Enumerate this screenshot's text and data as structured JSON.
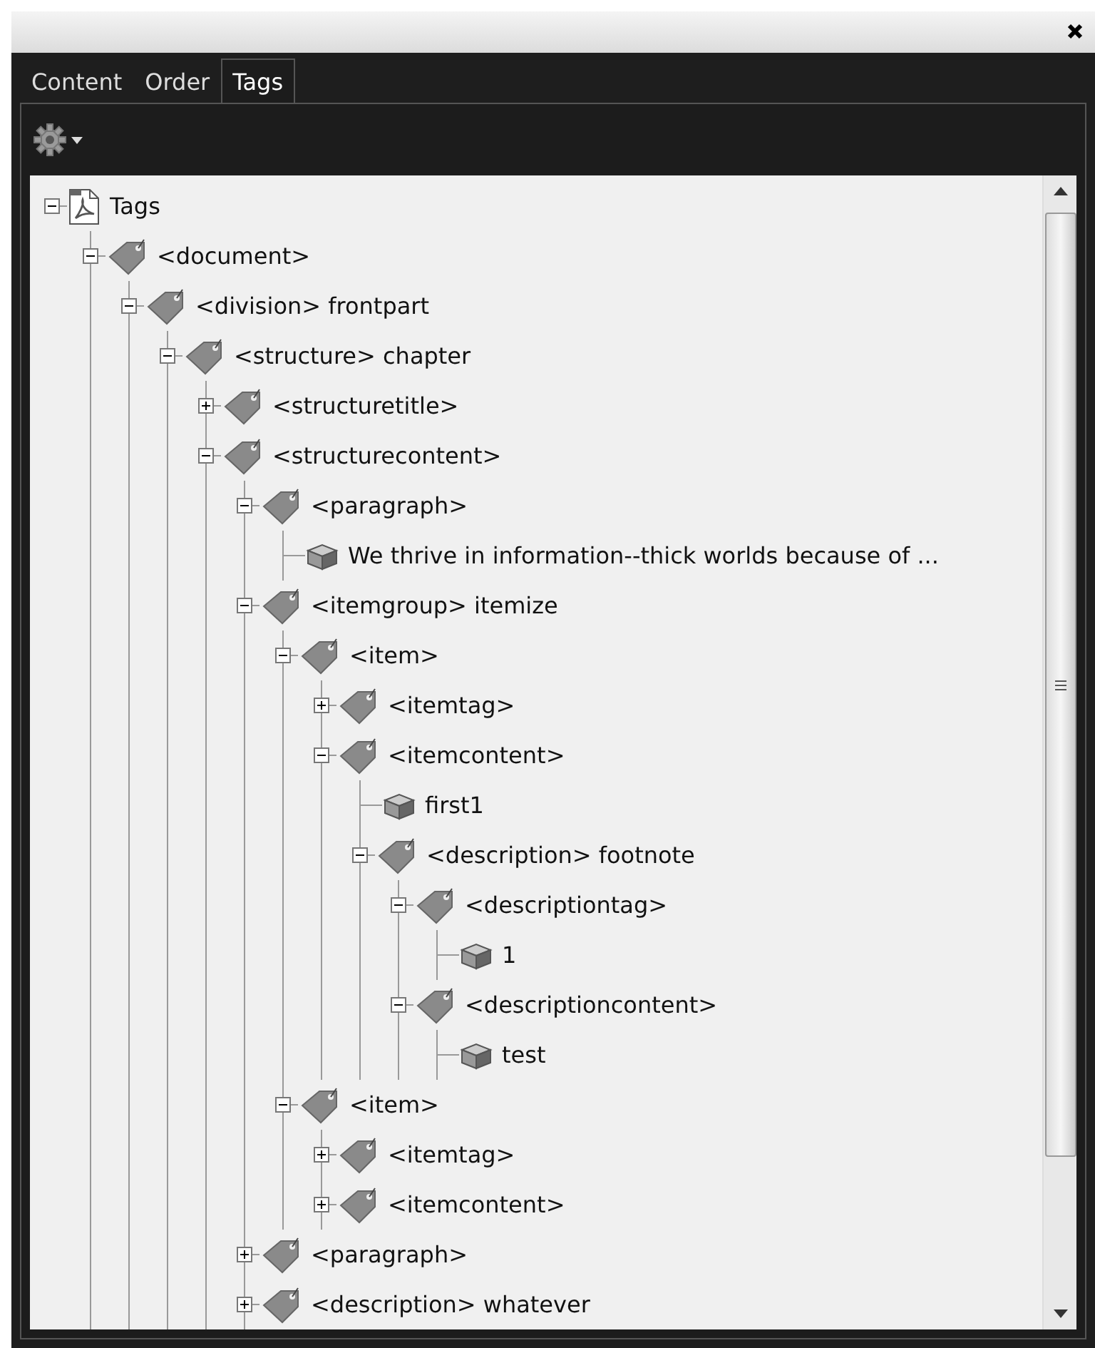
{
  "tabs": [
    {
      "label": "Content",
      "selected": false
    },
    {
      "label": "Order",
      "selected": false
    },
    {
      "label": "Tags",
      "selected": true
    }
  ],
  "tree": [
    {
      "kind": "pdf",
      "label": "Tags",
      "expanded": true,
      "children": [
        {
          "kind": "tag",
          "label": "<document>",
          "expanded": true,
          "children": [
            {
              "kind": "tag",
              "label": "<division> frontpart",
              "expanded": true,
              "children": [
                {
                  "kind": "tag",
                  "label": "<structure> chapter",
                  "expanded": true,
                  "children": [
                    {
                      "kind": "tag",
                      "label": "<structuretitle>",
                      "expanded": false
                    },
                    {
                      "kind": "tag",
                      "label": "<structurecontent>",
                      "expanded": true,
                      "children": [
                        {
                          "kind": "tag",
                          "label": "<paragraph>",
                          "expanded": true,
                          "children": [
                            {
                              "kind": "content",
                              "label": "We thrive in information--thick worlds because of ..."
                            }
                          ]
                        },
                        {
                          "kind": "tag",
                          "label": "<itemgroup> itemize",
                          "expanded": true,
                          "children": [
                            {
                              "kind": "tag",
                              "label": "<item>",
                              "expanded": true,
                              "children": [
                                {
                                  "kind": "tag",
                                  "label": "<itemtag>",
                                  "expanded": false
                                },
                                {
                                  "kind": "tag",
                                  "label": "<itemcontent>",
                                  "expanded": true,
                                  "children": [
                                    {
                                      "kind": "content",
                                      "label": "first1"
                                    },
                                    {
                                      "kind": "tag",
                                      "label": "<description> footnote",
                                      "expanded": true,
                                      "children": [
                                        {
                                          "kind": "tag",
                                          "label": "<descriptiontag>",
                                          "expanded": true,
                                          "children": [
                                            {
                                              "kind": "content",
                                              "label": "1"
                                            }
                                          ]
                                        },
                                        {
                                          "kind": "tag",
                                          "label": "<descriptioncontent>",
                                          "expanded": true,
                                          "children": [
                                            {
                                              "kind": "content",
                                              "label": "test"
                                            }
                                          ]
                                        }
                                      ]
                                    }
                                  ]
                                }
                              ]
                            },
                            {
                              "kind": "tag",
                              "label": "<item>",
                              "expanded": true,
                              "children": [
                                {
                                  "kind": "tag",
                                  "label": "<itemtag>",
                                  "expanded": false
                                },
                                {
                                  "kind": "tag",
                                  "label": "<itemcontent>",
                                  "expanded": false
                                }
                              ]
                            }
                          ]
                        },
                        {
                          "kind": "tag",
                          "label": "<paragraph>",
                          "expanded": false
                        },
                        {
                          "kind": "tag",
                          "label": "<description> whatever",
                          "expanded": false
                        }
                      ]
                    }
                  ]
                }
              ]
            }
          ]
        }
      ]
    }
  ]
}
